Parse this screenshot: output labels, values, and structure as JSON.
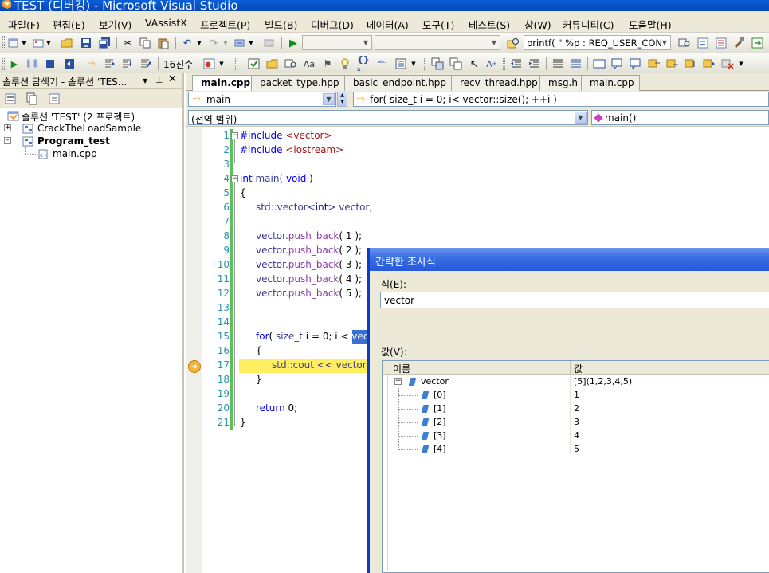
{
  "window": {
    "title": "TEST (디버깅) - Microsoft Visual Studio"
  },
  "menu": [
    "파일(F)",
    "편집(E)",
    "보기(V)",
    "VAssistX",
    "프로젝트(P)",
    "빌드(B)",
    "디버그(D)",
    "데이터(A)",
    "도구(T)",
    "테스트(S)",
    "창(W)",
    "커뮤니티(C)",
    "도움말(H)"
  ],
  "toolbar1": {
    "find_combo": "printf( \" %p : REQ_USER_CON",
    "config_combo": "",
    "platform_combo": ""
  },
  "toolbar2": {
    "hex_label": "16진수"
  },
  "solution_explorer": {
    "header": "솔루션 탐색기 - 솔루션 'TES...",
    "tree": [
      {
        "label": "솔루션 'TEST' (2 프로젝트)",
        "expander": ""
      },
      {
        "label": "CrackTheLoadSample",
        "expander": "+"
      },
      {
        "label": "Program_test",
        "expander": "-"
      },
      {
        "label": "main.cpp",
        "expander": ""
      }
    ]
  },
  "tabs": [
    "main.cpp",
    "packet_type.hpp",
    "basic_endpoint.hpp",
    "recv_thread.hpp",
    "msg.h",
    "main.cpp"
  ],
  "nav": {
    "scope": "main",
    "member": "for( size_t i = 0; i< vector::size(); ++i )",
    "scope2": "(전역 범위)",
    "member2": "main()"
  },
  "code": {
    "lines": [
      "1",
      "2",
      "3",
      "4",
      "5",
      "6",
      "7",
      "8",
      "9",
      "10",
      "11",
      "12",
      "13",
      "14",
      "15",
      "16",
      "17",
      "18",
      "19",
      "20",
      "21"
    ],
    "include1_kw": "#include",
    "include1_hdr": "<vector>",
    "include2_kw": "#include",
    "include2_hdr": "<iostream>",
    "l4_kw": "int",
    "l4_rest": " main( ",
    "l4_void": "void",
    "l4_end": " )",
    "l5": "{",
    "l6_ns": "std::vector<",
    "l6_kw": "int",
    "l6_rest": "> vector;",
    "l8_obj": "vector.",
    "l8_fn": "push_back",
    "l8_arg": "( 1 );",
    "l9_obj": "vector.",
    "l9_fn": "push_back",
    "l9_arg": "( 2 );",
    "l10_obj": "vector.",
    "l10_fn": "push_back",
    "l10_arg": "( 3 );",
    "l11_obj": "vector.",
    "l11_fn": "push_back",
    "l11_arg": "( 4 );",
    "l12_obj": "vector.",
    "l12_fn": "push_back",
    "l12_arg": "( 5 );",
    "l15_kw": "for",
    "l15_a": "( ",
    "l15_type": "size_t",
    "l15_b": " i = 0; i < ",
    "l15_sel": "vec",
    "l16": "{",
    "l17_a": "std::cout << vector[",
    "l18": "}",
    "l20_kw": "return",
    "l20_rest": " 0;",
    "l21": "}"
  },
  "quickwatch": {
    "title": "간략한 조사식",
    "expr_label": "식(E):",
    "expr_value": "vector",
    "value_label": "값(V):",
    "col_name": "이름",
    "col_value": "값",
    "rows": [
      {
        "name": "vector",
        "value": "[5](1,2,3,4,5)",
        "expander": "−"
      },
      {
        "name": "[0]",
        "value": "1"
      },
      {
        "name": "[1]",
        "value": "2"
      },
      {
        "name": "[2]",
        "value": "3"
      },
      {
        "name": "[3]",
        "value": "4"
      },
      {
        "name": "[4]",
        "value": "5"
      }
    ]
  }
}
